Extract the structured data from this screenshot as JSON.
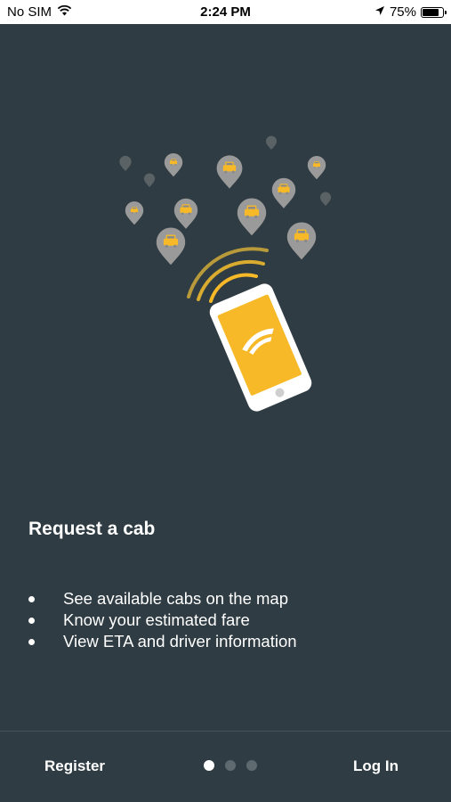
{
  "status_bar": {
    "carrier": "No SIM",
    "time": "2:24 PM",
    "battery": "75%",
    "battery_level": 0.75,
    "icons": [
      "wifi-icon",
      "location-arrow-icon",
      "battery-icon"
    ]
  },
  "onboarding": {
    "title": "Request a cab",
    "features": [
      "See available cabs on the map",
      "Know your estimated fare",
      "View ETA and driver information"
    ],
    "pages": 3,
    "active_page": 1
  },
  "footer": {
    "register_label": "Register",
    "login_label": "Log In"
  },
  "colors": {
    "background": "#2f3c43",
    "accent": "#f7b928",
    "pin": "#9a9a9a"
  }
}
